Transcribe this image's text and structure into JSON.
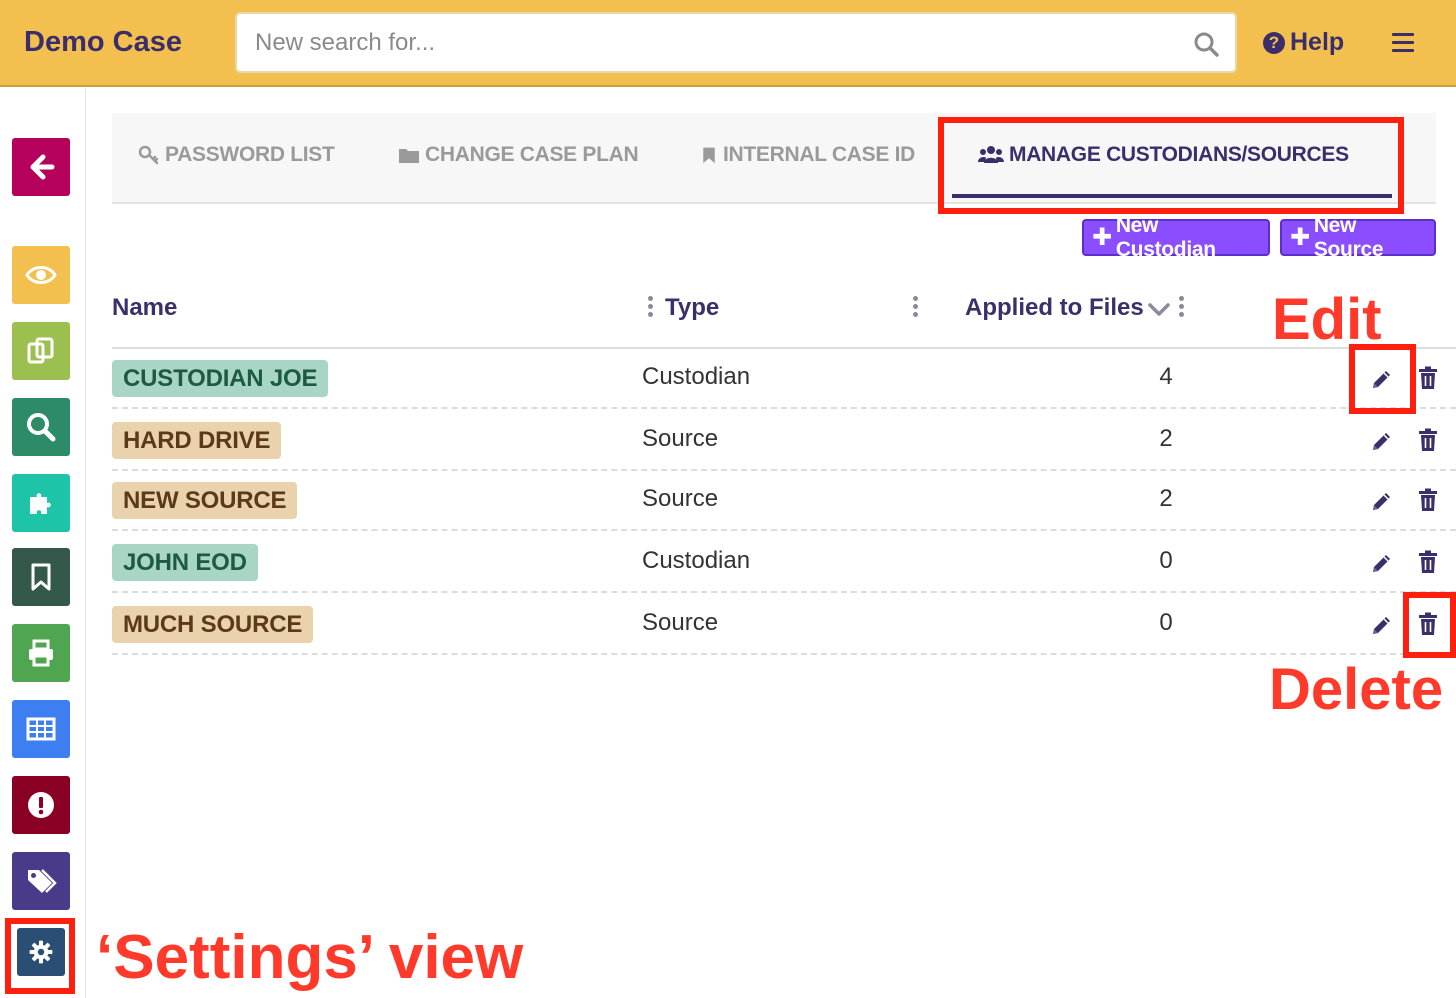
{
  "app": {
    "title": "Demo Case"
  },
  "search": {
    "placeholder": "New search for..."
  },
  "header": {
    "help_label": "Help"
  },
  "sidebar": {
    "items": [
      {
        "name": "back",
        "color": "#b5005c",
        "icon": "arrow-left-icon"
      },
      {
        "name": "view",
        "color": "#f3c04f",
        "icon": "eye-icon"
      },
      {
        "name": "copies",
        "color": "#9cc050",
        "icon": "copy-icon"
      },
      {
        "name": "search",
        "color": "#2e8b67",
        "icon": "search-icon"
      },
      {
        "name": "plugins",
        "color": "#1dc4a8",
        "icon": "puzzle-icon"
      },
      {
        "name": "bookmarks",
        "color": "#34584a",
        "icon": "bookmark-icon"
      },
      {
        "name": "print",
        "color": "#50a650",
        "icon": "print-icon"
      },
      {
        "name": "table",
        "color": "#3d7ff0",
        "icon": "table-icon"
      },
      {
        "name": "alerts",
        "color": "#8a0024",
        "icon": "exclamation-icon"
      },
      {
        "name": "tags",
        "color": "#4b3a8a",
        "icon": "tags-icon"
      },
      {
        "name": "settings",
        "color": "#2b4e74",
        "icon": "gear-icon"
      }
    ]
  },
  "tabs": [
    {
      "label": "PASSWORD LIST",
      "icon": "key-icon",
      "active": false
    },
    {
      "label": "CHANGE CASE PLAN",
      "icon": "folder-icon",
      "active": false
    },
    {
      "label": "INTERNAL CASE ID",
      "icon": "bookmark-icon",
      "active": false
    },
    {
      "label": "MANAGE CUSTODIANS/SOURCES",
      "icon": "users-icon",
      "active": true
    }
  ],
  "actions": {
    "new_custodian": "New Custodian",
    "new_source": "New Source"
  },
  "table": {
    "columns": [
      "Name",
      "Type",
      "Applied to Files"
    ],
    "rows": [
      {
        "name": "CUSTODIAN JOE",
        "type": "Custodian",
        "files": "4"
      },
      {
        "name": "HARD DRIVE",
        "type": "Source",
        "files": "2"
      },
      {
        "name": "NEW SOURCE",
        "type": "Source",
        "files": "2"
      },
      {
        "name": "JOHN EOD",
        "type": "Custodian",
        "files": "0"
      },
      {
        "name": "MUCH SOURCE",
        "type": "Source",
        "files": "0"
      }
    ]
  },
  "annotations": {
    "edit": "Edit",
    "delete": "Delete",
    "settings": "‘Settings’ view"
  },
  "colors": {
    "header": "#f3c04f",
    "brand": "#3b2f6b",
    "button": "#8a4dff",
    "highlight": "#ff1f0f"
  }
}
